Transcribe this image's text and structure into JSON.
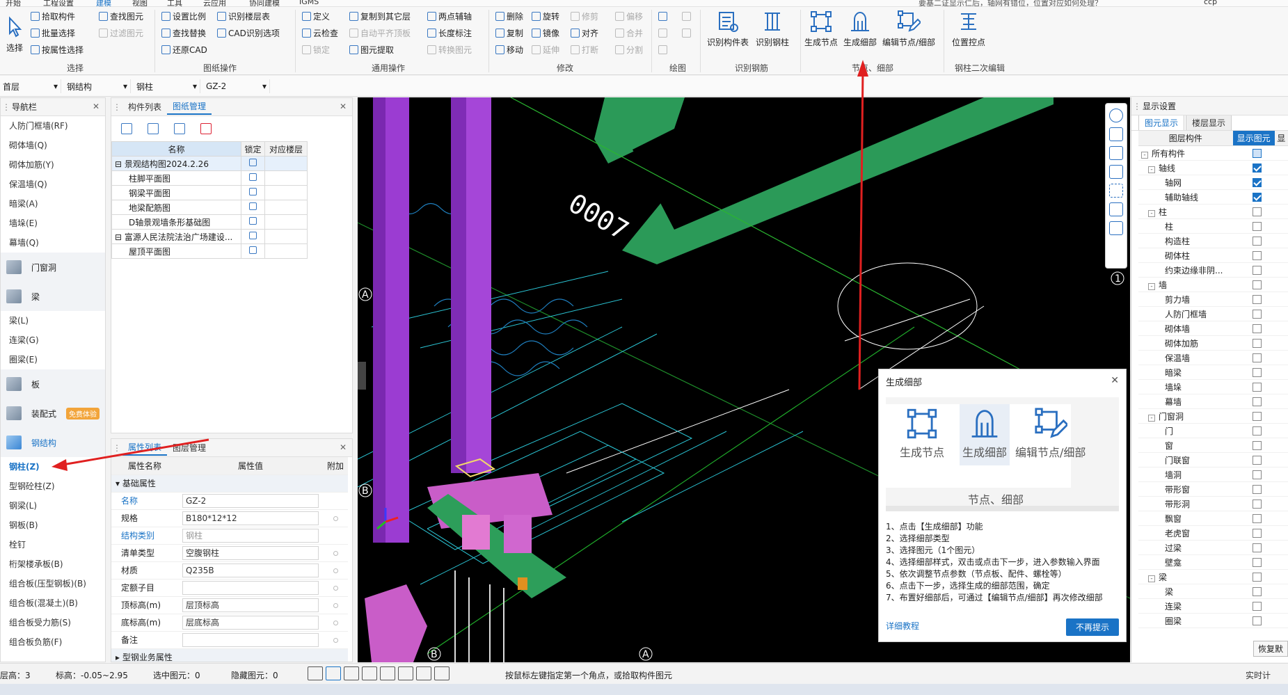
{
  "menu": {
    "items": [
      "开始",
      "工程设置",
      "建模",
      "视图",
      "工具",
      "云应用",
      "协同建模",
      "IGMS"
    ],
    "active_index": 2,
    "right_text": "要基二证显示仁后，轴网有错位，位置对应如何处理？",
    "user": "ccp"
  },
  "ribbon": {
    "select_big": "选择",
    "select_small": [
      "拾取构件",
      "批量选择",
      "按属性选择"
    ],
    "find_small": [
      "查找图元",
      "过滤图元"
    ],
    "select_group": "选择",
    "cad_ops": [
      "设置比例",
      "识别楼层表",
      "查找替换",
      "CAD识别选项",
      "还原CAD"
    ],
    "cad_group": "图纸操作",
    "common_col1": [
      "定义",
      "云检查",
      "锁定"
    ],
    "common_col2": [
      "复制到其它层",
      "自动平齐顶板",
      "图元提取"
    ],
    "common_col3": [
      "两点辅轴",
      "长度标注",
      "转换图元"
    ],
    "common_group": "通用操作",
    "modify_col1": [
      "删除",
      "复制",
      "移动"
    ],
    "modify_col2": [
      "旋转",
      "镜像",
      "延伸"
    ],
    "modify_col3": [
      "修剪",
      "对齐",
      "打断"
    ],
    "modify_col4": [
      "偏移",
      "合并",
      "分割"
    ],
    "modify_group": "修改",
    "draw_group": "绘图",
    "rebar_buttons": [
      "识别构件表",
      "识别钢柱"
    ],
    "rebar_group": "识别钢筋",
    "node_buttons": [
      "生成节点",
      "生成细部",
      "编辑节点/细部"
    ],
    "node_group": "节点、细部",
    "second_buttons": [
      "位置控点"
    ],
    "second_group": "钢柱二次编辑"
  },
  "selbar": {
    "floor": "首层",
    "category": "钢结构",
    "type": "钢柱",
    "name": "GZ-2"
  },
  "nav": {
    "title": "导航栏",
    "items_top": [
      "人防门框墙(RF)",
      "砌体墙(Q)",
      "砌体加筋(Y)",
      "保温墙(Q)",
      "暗梁(A)",
      "墙垛(E)",
      "幕墙(Q)"
    ],
    "cat_door": "门窗洞",
    "cat_beam": "梁",
    "beam_items": [
      "梁(L)",
      "连梁(G)",
      "圈梁(E)"
    ],
    "cat_slab": "板",
    "cat_prefab": "装配式",
    "prefab_badge": "免费体验",
    "cat_steel": "钢结构",
    "steel_items": [
      "钢柱(Z)",
      "型钢砼柱(Z)",
      "钢梁(L)",
      "钢板(B)",
      "栓钉",
      "桁架楼承板(B)",
      "组合板(压型钢板)(B)",
      "组合板(混凝土)(B)",
      "组合板受力筋(S)",
      "组合板负筋(F)"
    ]
  },
  "drawing_panel": {
    "tabs": [
      "构件列表",
      "图纸管理"
    ],
    "active_tab": 1,
    "columns": [
      "名称",
      "锁定",
      "对应楼层"
    ],
    "rows": [
      {
        "name": "景观结构图2024.2.26",
        "level": 0,
        "group": true,
        "selected": true
      },
      {
        "name": "柱脚平面图",
        "level": 1
      },
      {
        "name": "钢梁平面图",
        "level": 1
      },
      {
        "name": "地梁配筋图",
        "level": 1
      },
      {
        "name": "D轴景观墙条形基础图",
        "level": 1
      },
      {
        "name": "富源人民法院法治广场建设...",
        "level": 0,
        "group": true
      },
      {
        "name": "屋顶平面图",
        "level": 1
      }
    ]
  },
  "props": {
    "tabs": [
      "属性列表",
      "图层管理"
    ],
    "active_tab": 0,
    "columns": [
      "属性名称",
      "属性值",
      "附加"
    ],
    "section": "基础属性",
    "rows": [
      {
        "name": "名称",
        "value": "GZ-2",
        "blue": true
      },
      {
        "name": "规格",
        "value": "B180*12*12",
        "dot": true
      },
      {
        "name": "结构类别",
        "value": "钢柱",
        "blue": true,
        "dim": true
      },
      {
        "name": "清单类型",
        "value": "空腹钢柱",
        "dot": true
      },
      {
        "name": "材质",
        "value": "Q235B",
        "dot": true
      },
      {
        "name": "定额子目",
        "value": "",
        "dot": true
      },
      {
        "name": "顶标高(m)",
        "value": "层顶标高",
        "dot": true
      },
      {
        "name": "底标高(m)",
        "value": "层底标高",
        "dot": true
      },
      {
        "name": "备注",
        "value": "",
        "dot": true
      }
    ],
    "section2": "型钢业务属性"
  },
  "viewport": {
    "axis_labels": [
      "A",
      "B",
      "1",
      "B",
      "A"
    ],
    "cad_text": "0007"
  },
  "dialog": {
    "title": "生成细部",
    "buttons": [
      "生成节点",
      "生成细部",
      "编辑节点/细部"
    ],
    "group": "节点、细部",
    "steps": [
      "1、点击【生成细部】功能",
      "2、选择细部类型",
      "3、选择图元（1个图元）",
      "4、选择细部样式，双击或点击下一步，进入参数输入界面",
      "5、依次调整节点参数（节点板、配件、螺栓等）",
      "6、点击下一步，选择生成的细部范围，确定",
      "7、布置好细部后，可通过【编辑节点/细部】再次修改细部"
    ],
    "link": "详细教程",
    "confirm": "不再提示"
  },
  "display": {
    "title": "显示设置",
    "tabs": [
      "图元显示",
      "楼层显示"
    ],
    "active_tab": 0,
    "columns": [
      "图层构件",
      "显示图元",
      "显"
    ],
    "rows": [
      {
        "label": "所有构件",
        "level": 0,
        "exp": "-",
        "checked": false,
        "partial": true
      },
      {
        "label": "轴线",
        "level": 1,
        "exp": "-",
        "checked": true
      },
      {
        "label": "轴网",
        "level": 2,
        "checked": true
      },
      {
        "label": "辅助轴线",
        "level": 2,
        "checked": true
      },
      {
        "label": "柱",
        "level": 1,
        "exp": "-",
        "checked": false
      },
      {
        "label": "柱",
        "level": 2,
        "checked": false
      },
      {
        "label": "构造柱",
        "level": 2,
        "checked": false
      },
      {
        "label": "砌体柱",
        "level": 2,
        "checked": false
      },
      {
        "label": "约束边缘非阴...",
        "level": 2,
        "checked": false
      },
      {
        "label": "墙",
        "level": 1,
        "exp": "-",
        "checked": false
      },
      {
        "label": "剪力墙",
        "level": 2,
        "checked": false
      },
      {
        "label": "人防门框墙",
        "level": 2,
        "checked": false
      },
      {
        "label": "砌体墙",
        "level": 2,
        "checked": false
      },
      {
        "label": "砌体加筋",
        "level": 2,
        "checked": false
      },
      {
        "label": "保温墙",
        "level": 2,
        "checked": false
      },
      {
        "label": "暗梁",
        "level": 2,
        "checked": false
      },
      {
        "label": "墙垛",
        "level": 2,
        "checked": false
      },
      {
        "label": "幕墙",
        "level": 2,
        "checked": false
      },
      {
        "label": "门窗洞",
        "level": 1,
        "exp": "-",
        "checked": false
      },
      {
        "label": "门",
        "level": 2,
        "checked": false
      },
      {
        "label": "窗",
        "level": 2,
        "checked": false
      },
      {
        "label": "门联窗",
        "level": 2,
        "checked": false
      },
      {
        "label": "墙洞",
        "level": 2,
        "checked": false
      },
      {
        "label": "带形窗",
        "level": 2,
        "checked": false
      },
      {
        "label": "带形洞",
        "level": 2,
        "checked": false
      },
      {
        "label": "飘窗",
        "level": 2,
        "checked": false
      },
      {
        "label": "老虎窗",
        "level": 2,
        "checked": false
      },
      {
        "label": "过梁",
        "level": 2,
        "checked": false
      },
      {
        "label": "壁龛",
        "level": 2,
        "checked": false
      },
      {
        "label": "梁",
        "level": 1,
        "exp": "-",
        "checked": false
      },
      {
        "label": "梁",
        "level": 2,
        "checked": false
      },
      {
        "label": "连梁",
        "level": 2,
        "checked": false
      },
      {
        "label": "圈梁",
        "level": 2,
        "checked": false
      }
    ],
    "restore": "恢复默"
  },
  "status": {
    "floor_h": "层高：3",
    "elev": "标高：-0.05~2.95",
    "selected": "选中图元：0",
    "hidden": "隐藏图元：0",
    "hint": "按鼠标左键指定第一个角点，或拾取构件图元",
    "realtime": "实时计"
  },
  "colors": {
    "accent": "#1a73c6",
    "arrow": "#e02020",
    "column": "#a040d0",
    "base": "#2d9e5a"
  }
}
